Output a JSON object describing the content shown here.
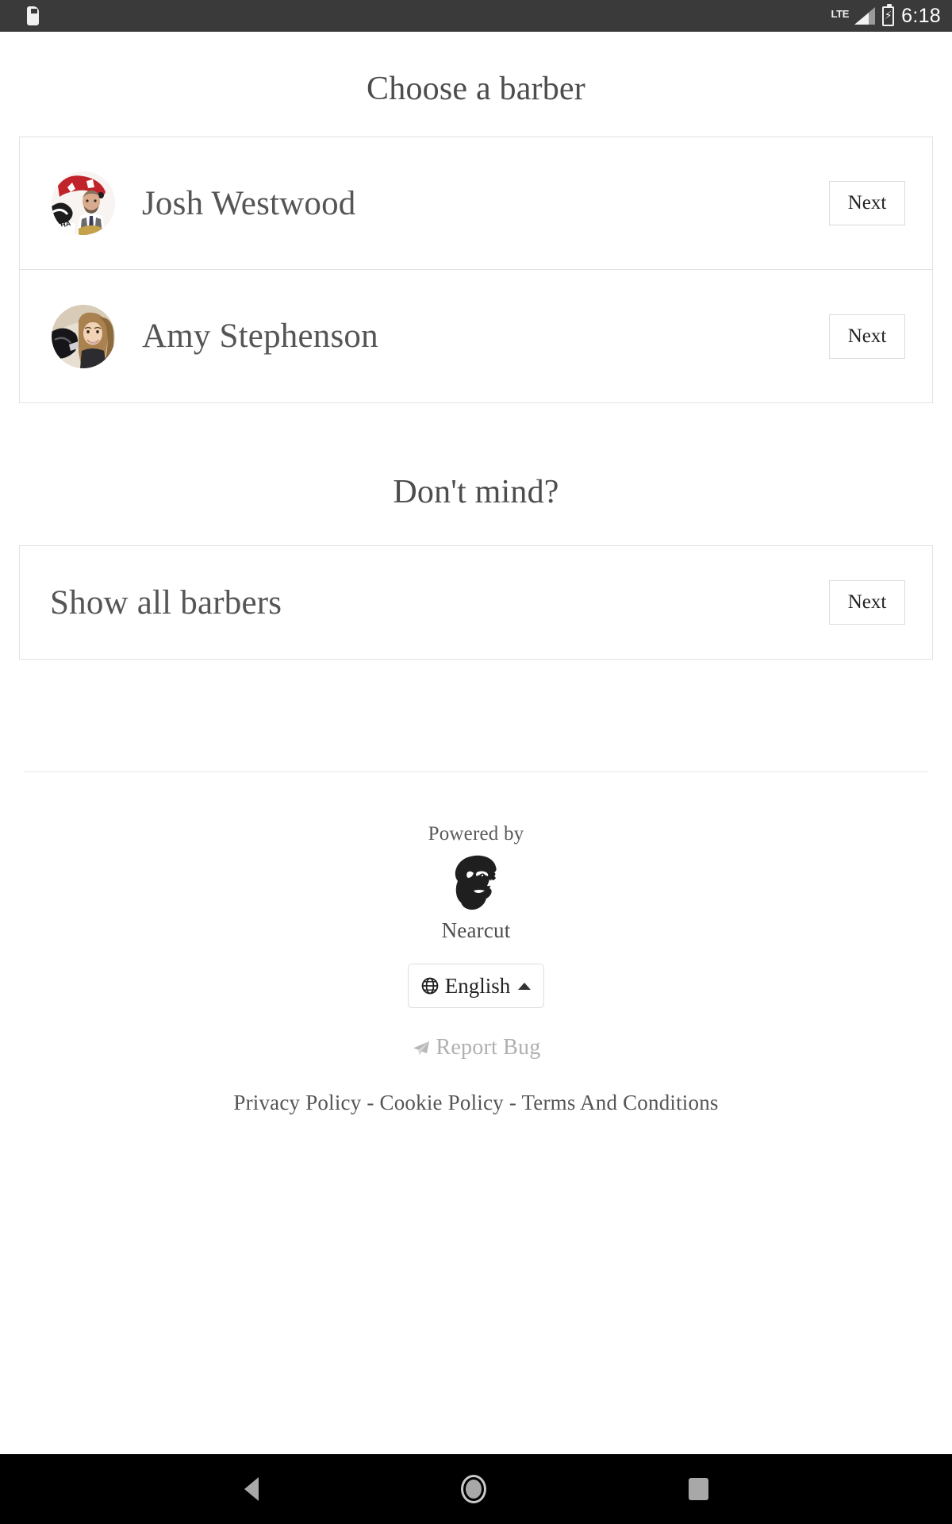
{
  "status_bar": {
    "sd_card_icon": "sd-card-icon",
    "network_label": "LTE",
    "signal_icon": "signal-bars-icon",
    "battery_icon": "battery-charging-icon",
    "time": "6:18"
  },
  "page": {
    "title": "Choose a barber",
    "subtitle": "Don't mind?"
  },
  "barbers": [
    {
      "name": "Josh Westwood",
      "avatar_icon": "avatar-josh-westwood",
      "next_label": "Next"
    },
    {
      "name": "Amy Stephenson",
      "avatar_icon": "avatar-amy-stephenson",
      "next_label": "Next"
    }
  ],
  "show_all": {
    "label": "Show all barbers",
    "next_label": "Next"
  },
  "footer": {
    "powered_by": "Powered by",
    "brand": "Nearcut",
    "brand_logo_icon": "nearcut-bearded-man-logo",
    "language": {
      "globe_icon": "globe-icon",
      "value": "English",
      "caret_icon": "caret-up-icon"
    },
    "report_bug": {
      "icon": "paper-plane-icon",
      "label": "Report Bug"
    },
    "legal": {
      "privacy": "Privacy Policy",
      "separator_1": "-",
      "cookie": "Cookie Policy",
      "separator_2": "-",
      "terms": "Terms And Conditions"
    }
  },
  "nav_bar": {
    "back_icon": "back-triangle-icon",
    "home_icon": "home-circle-icon",
    "recent_icon": "recent-apps-square-icon"
  },
  "colors": {
    "status_bar_bg": "#3a3a3a",
    "nav_bar_bg": "#000000",
    "page_bg": "#ffffff",
    "text_primary": "#555555",
    "border": "#e2e2e2",
    "muted": "#b0b0b0"
  }
}
